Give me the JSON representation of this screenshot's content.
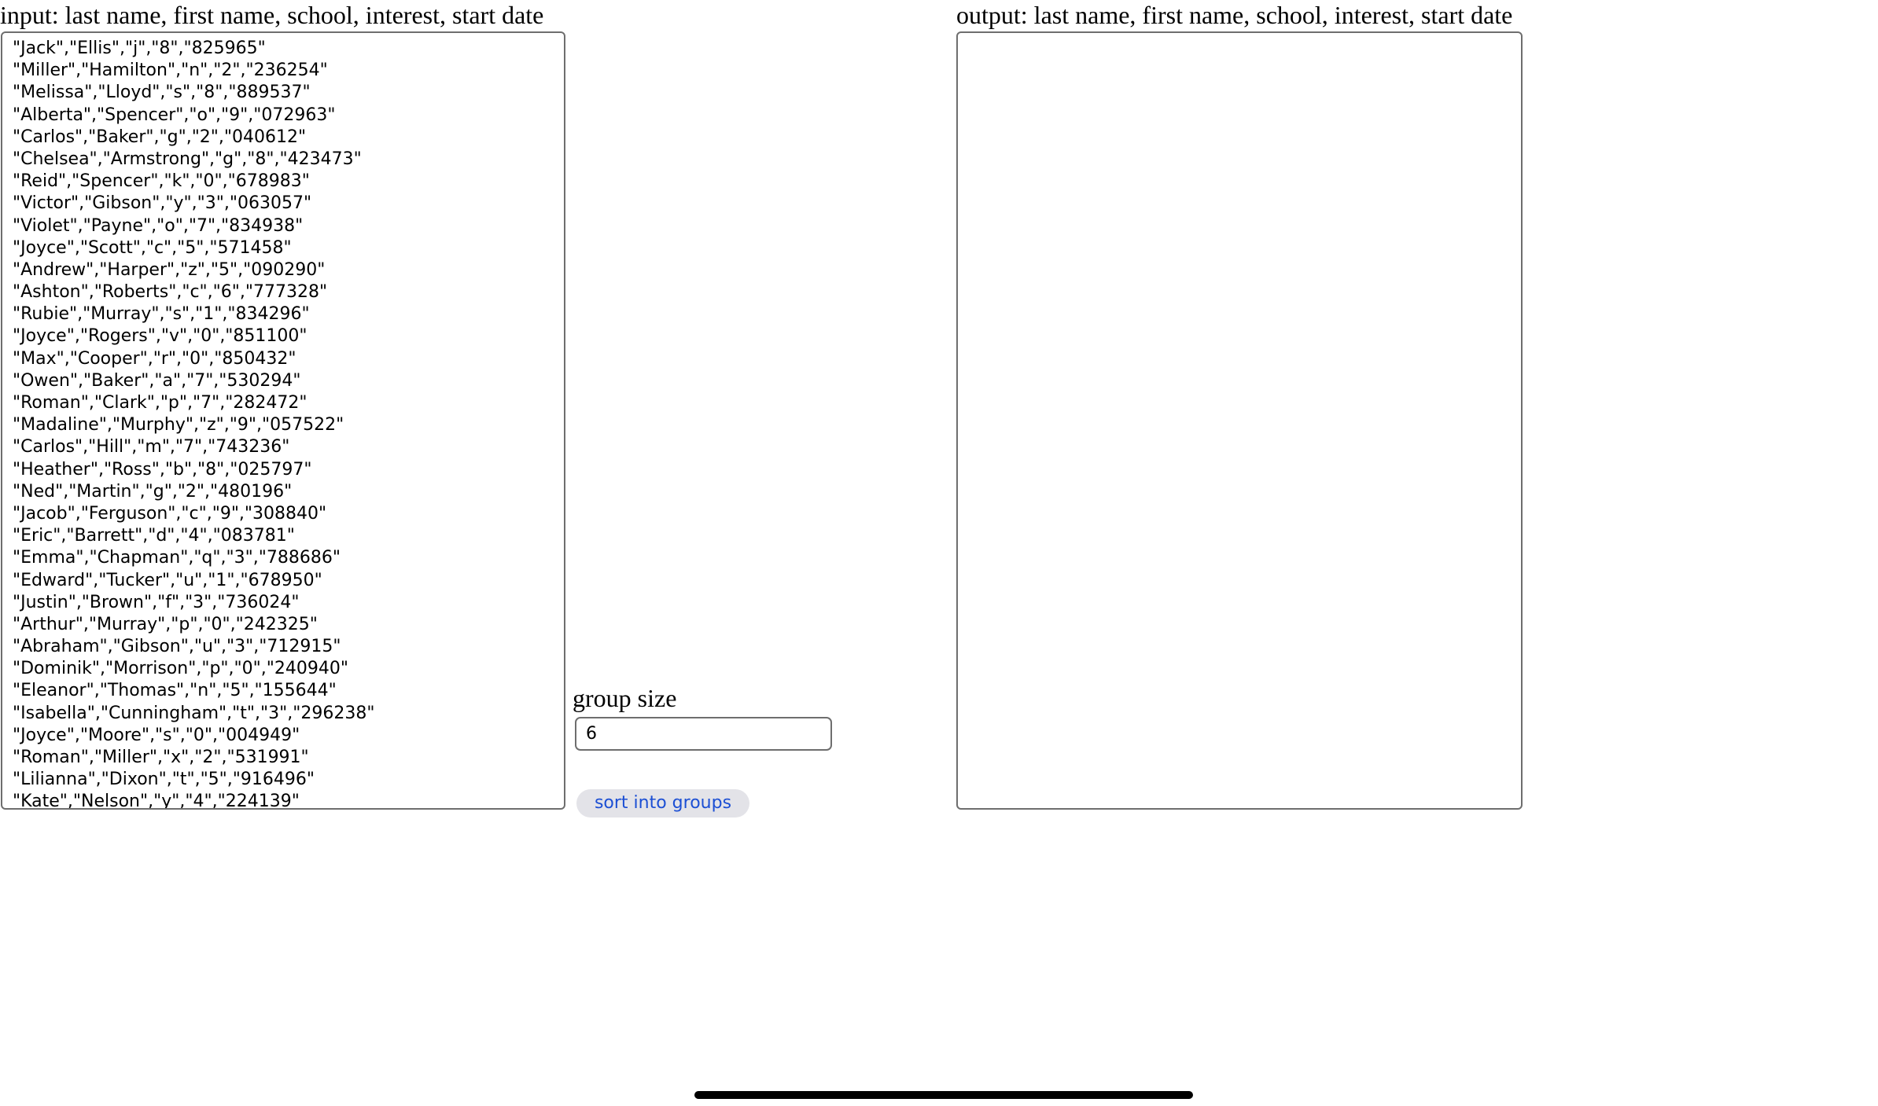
{
  "input": {
    "label": "input: last name, first name, school, interest, start date",
    "rows": [
      "\"Jack\",\"Ellis\",\"j\",\"8\",\"825965\"",
      "\"Miller\",\"Hamilton\",\"n\",\"2\",\"236254\"",
      "\"Melissa\",\"Lloyd\",\"s\",\"8\",\"889537\"",
      "\"Alberta\",\"Spencer\",\"o\",\"9\",\"072963\"",
      "\"Carlos\",\"Baker\",\"g\",\"2\",\"040612\"",
      "\"Chelsea\",\"Armstrong\",\"g\",\"8\",\"423473\"",
      "\"Reid\",\"Spencer\",\"k\",\"0\",\"678983\"",
      "\"Victor\",\"Gibson\",\"y\",\"3\",\"063057\"",
      "\"Violet\",\"Payne\",\"o\",\"7\",\"834938\"",
      "\"Joyce\",\"Scott\",\"c\",\"5\",\"571458\"",
      "\"Andrew\",\"Harper\",\"z\",\"5\",\"090290\"",
      "\"Ashton\",\"Roberts\",\"c\",\"6\",\"777328\"",
      "\"Rubie\",\"Murray\",\"s\",\"1\",\"834296\"",
      "\"Joyce\",\"Rogers\",\"v\",\"0\",\"851100\"",
      "\"Max\",\"Cooper\",\"r\",\"0\",\"850432\"",
      "\"Owen\",\"Baker\",\"a\",\"7\",\"530294\"",
      "\"Roman\",\"Clark\",\"p\",\"7\",\"282472\"",
      "\"Madaline\",\"Murphy\",\"z\",\"9\",\"057522\"",
      "\"Carlos\",\"Hill\",\"m\",\"7\",\"743236\"",
      "\"Heather\",\"Ross\",\"b\",\"8\",\"025797\"",
      "\"Ned\",\"Martin\",\"g\",\"2\",\"480196\"",
      "\"Jacob\",\"Ferguson\",\"c\",\"9\",\"308840\"",
      "\"Eric\",\"Barrett\",\"d\",\"4\",\"083781\"",
      "\"Emma\",\"Chapman\",\"q\",\"3\",\"788686\"",
      "\"Edward\",\"Tucker\",\"u\",\"1\",\"678950\"",
      "\"Justin\",\"Brown\",\"f\",\"3\",\"736024\"",
      "\"Arthur\",\"Murray\",\"p\",\"0\",\"242325\"",
      "\"Abraham\",\"Gibson\",\"u\",\"3\",\"712915\"",
      "\"Dominik\",\"Morrison\",\"p\",\"0\",\"240940\"",
      "\"Eleanor\",\"Thomas\",\"n\",\"5\",\"155644\"",
      "\"Isabella\",\"Cunningham\",\"t\",\"3\",\"296238\"",
      "\"Joyce\",\"Moore\",\"s\",\"0\",\"004949\"",
      "\"Roman\",\"Miller\",\"x\",\"2\",\"531991\"",
      "\"Lilianna\",\"Dixon\",\"t\",\"5\",\"916496\"",
      "\"Kate\",\"Nelson\",\"y\",\"4\",\"224139\""
    ]
  },
  "output": {
    "label": "output: last name, first name, school, interest, start date",
    "value": ""
  },
  "group_size": {
    "label": "group size",
    "value": "6"
  },
  "sort_button": {
    "label": "sort into groups"
  },
  "colors": {
    "button_background": "#e3e3e8",
    "button_text": "#1c4fd4",
    "border": "#6e6e6e"
  }
}
